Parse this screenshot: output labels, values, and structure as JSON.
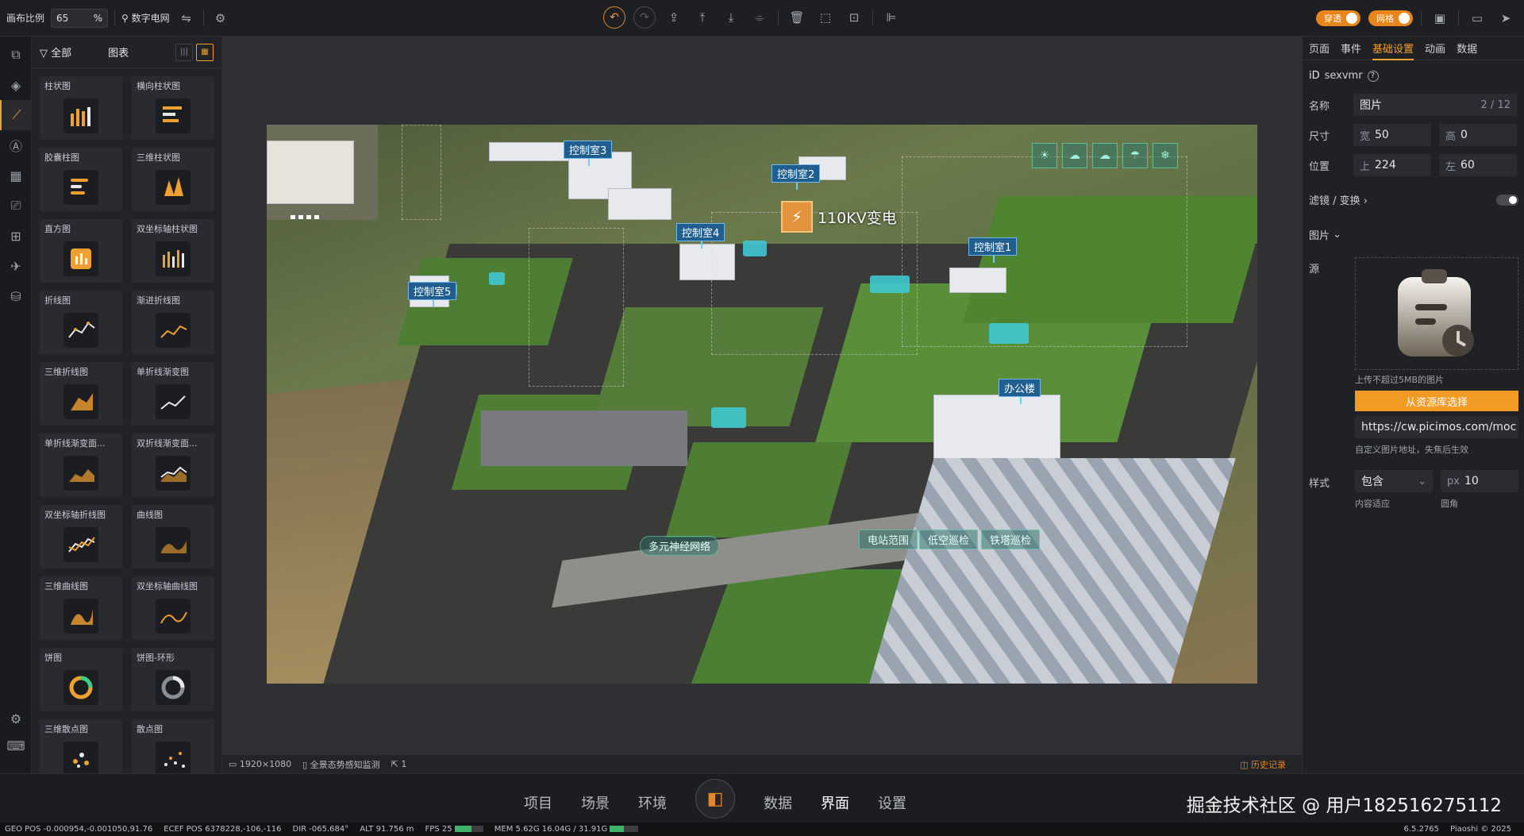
{
  "toolbar": {
    "scale_label": "画布比例",
    "scale_value": "65",
    "scale_unit": "%",
    "project_name": "数字电网",
    "toggle_left": "穿透",
    "toggle_right": "网格"
  },
  "rail": [
    "components",
    "layers",
    "charts",
    "text",
    "table",
    "media",
    "widgets",
    "send",
    "data"
  ],
  "component_panel": {
    "filter_label": "全部",
    "category_label": "图表",
    "items": [
      {
        "label": "柱状图",
        "icon": "bar-icon"
      },
      {
        "label": "横向柱状图",
        "icon": "hbar-icon"
      },
      {
        "label": "胶囊柱图",
        "icon": "capsule-icon"
      },
      {
        "label": "三维柱状图",
        "icon": "bar3d-icon"
      },
      {
        "label": "直方图",
        "icon": "histogram-icon"
      },
      {
        "label": "双坐标轴柱状图",
        "icon": "dual-bar-icon"
      },
      {
        "label": "折线图",
        "icon": "line-icon"
      },
      {
        "label": "渐进折线图",
        "icon": "gradient-line-icon"
      },
      {
        "label": "三维折线图",
        "icon": "line3d-icon"
      },
      {
        "label": "单折线渐变图",
        "icon": "single-gradient-icon"
      },
      {
        "label": "单折线渐变面...",
        "icon": "area-gradient-icon"
      },
      {
        "label": "双折线渐变面...",
        "icon": "dual-area-icon"
      },
      {
        "label": "双坐标轴折线图",
        "icon": "dual-line-icon"
      },
      {
        "label": "曲线图",
        "icon": "curve-icon"
      },
      {
        "label": "三维曲线图",
        "icon": "curve3d-icon"
      },
      {
        "label": "双坐标轴曲线图",
        "icon": "dual-curve-icon"
      },
      {
        "label": "饼图",
        "icon": "pie-icon"
      },
      {
        "label": "饼图-环形",
        "icon": "ring-icon"
      },
      {
        "label": "三维散点图",
        "icon": "scatter3d-icon"
      },
      {
        "label": "散点图",
        "icon": "scatter-icon"
      }
    ]
  },
  "scene": {
    "title": "110KV变电",
    "tags": [
      {
        "id": "room3",
        "label": "控制室3"
      },
      {
        "id": "room2",
        "label": "控制室2"
      },
      {
        "id": "room4",
        "label": "控制室4"
      },
      {
        "id": "room1",
        "label": "控制室1"
      },
      {
        "id": "room5",
        "label": "控制室5"
      },
      {
        "id": "office",
        "label": "办公楼"
      }
    ],
    "bottom_buttons": [
      "电站范围",
      "低空巡检",
      "铁塔巡检"
    ],
    "network_button": "多元神经网络"
  },
  "stage_footer": {
    "resolution": "1920×1080",
    "scene_name": "全景态势感知监测",
    "count": "1",
    "history": "历史记录"
  },
  "props": {
    "tabs": [
      "页面",
      "事件",
      "基础设置",
      "动画",
      "数据"
    ],
    "active_tab": "基础设置",
    "id_label": "iD",
    "id_value": "sexvmr",
    "name_label": "名称",
    "name_value": "图片",
    "name_count": "2 / 12",
    "size_label": "尺寸",
    "width_label": "宽",
    "width_value": "50",
    "height_label": "高",
    "height_value": "0",
    "pos_label": "位置",
    "top_label": "上",
    "top_value": "224",
    "left_label": "左",
    "left_value": "60",
    "filter_label": "滤镜 / 变换",
    "image_section": "图片",
    "source_label": "源",
    "upload_hint": "上传不超过5MB的图片",
    "library_button": "从资源库选择",
    "url_value": "https://cw.picimos.com/moc",
    "url_hint": "自定义图片地址，失焦后生效",
    "style_label": "样式",
    "fit_value": "包含",
    "fit_hint": "内容适应",
    "radius_unit": "px",
    "radius_value": "10",
    "radius_hint": "圆角"
  },
  "bottom_nav": {
    "items": [
      "项目",
      "场景",
      "环境",
      "数据",
      "界面",
      "设置"
    ],
    "active": "界面",
    "watermark": "掘金技术社区 @ 用户182516275112"
  },
  "status": {
    "geo_label": "GEO POS",
    "geo_value": "-0.000954,-0.001050,91.76",
    "ecef_label": "ECEF POS",
    "ecef_value": "6378228,-106,-116",
    "dir_label": "DIR",
    "dir_value": "-065.684°",
    "alt_label": "ALT",
    "alt_value": "91.756 m",
    "fps_label": "FPS",
    "fps_value": "25",
    "fps_level": 0.6,
    "mem_label": "MEM",
    "mem_value": "5.62G",
    "mem_total": "16.04G / 31.91G",
    "mem_level": 0.5,
    "version": "6.5.2765",
    "copyright": "Piaoshi © 2025"
  },
  "colors": {
    "accent": "#f0a030",
    "panel": "#222327",
    "tag": "#1f5e8f"
  }
}
